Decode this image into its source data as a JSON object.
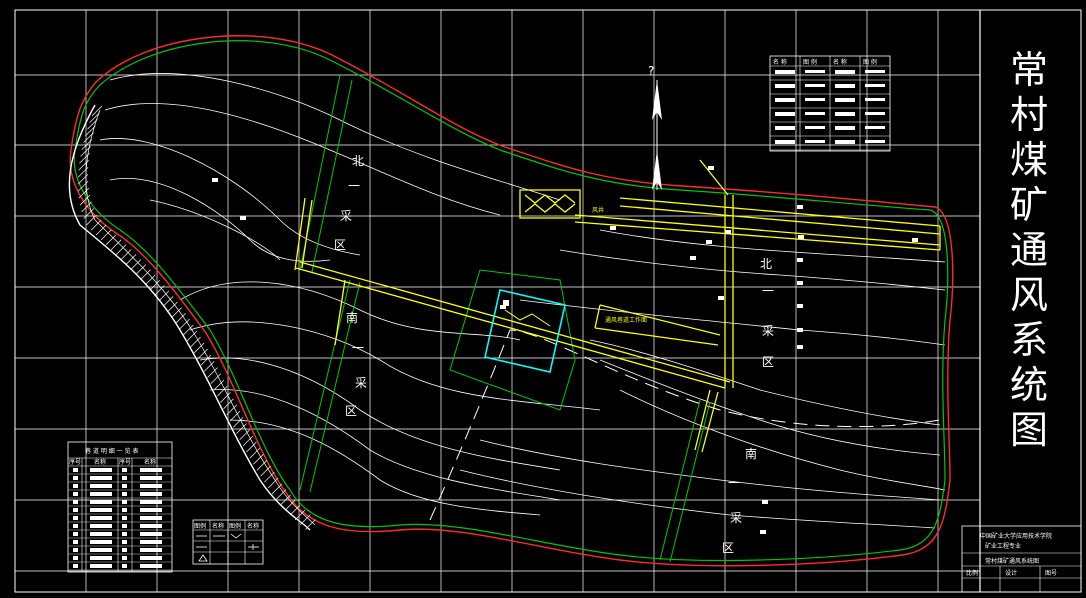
{
  "title": "常村煤矿通风系统图",
  "zones": {
    "north_1": [
      "北",
      "一",
      "采",
      "区"
    ],
    "north_2": [
      "北",
      "一",
      "采",
      "区"
    ],
    "south_1": [
      "南",
      "一",
      "采",
      "区"
    ],
    "south_2": [
      "南",
      "一",
      "采",
      "区"
    ]
  },
  "north_mark": "?",
  "tables": {
    "lane_table_title": "巷 道 明 细 一 览 表",
    "lane_table_headers": [
      "序号",
      "名称",
      "序号",
      "名称"
    ],
    "symbol_table_headers": [
      "图例",
      "名称",
      "图例",
      "名称"
    ],
    "legend_headers": [
      "名 称",
      "图 例",
      "名 称",
      "图 例"
    ]
  },
  "title_block": {
    "school": "中国矿业大学应用技术学院",
    "dept": "矿业工程专业",
    "drawing_name": "常村煤矿通风系统图",
    "footer": [
      "比例",
      "设计",
      "图号"
    ]
  },
  "colors": {
    "background": "#000000",
    "grid": "#ffffff",
    "boundary": "#ff2a2a",
    "mine_outline": "#00c800",
    "airways": "#ffff00",
    "contours": "#ffffff",
    "shaft": "#00ffff"
  },
  "icons": [
    "north-arrow-icon"
  ]
}
